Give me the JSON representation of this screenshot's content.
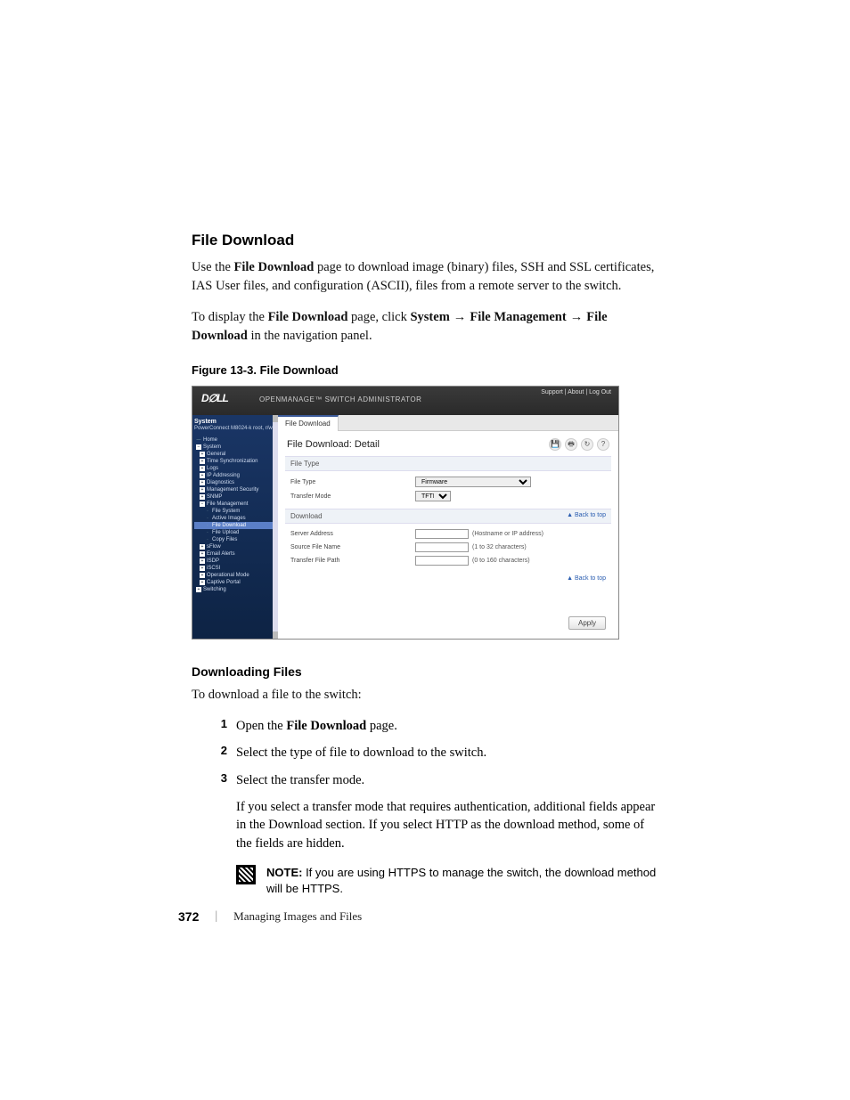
{
  "heading": "File Download",
  "intro": "Use the File Download page to download image (binary) files, SSH and SSL certificates, IAS User files, and configuration (ASCII), files from a remote server to the switch.",
  "intro_bold1": "File Download",
  "nav_text_pre": "To display the ",
  "nav_text_bold1": "File Download",
  "nav_text_mid1": " page, click ",
  "nav_text_bold2": "System",
  "nav_text_mid2": " → ",
  "nav_text_bold3": "File Management",
  "nav_text_mid3": " → ",
  "nav_text_bold4": "File Download",
  "nav_text_post": " in the navigation panel.",
  "figure_caption": "Figure 13-3.    File Download",
  "screenshot": {
    "logo": "D∅LL",
    "title": "OPENMANAGE™ SWITCH ADMINISTRATOR",
    "links": "Support | About | Log Out",
    "sidebar": {
      "system_label": "System",
      "system_sub": "PowerConnect M8024-k root, r/w",
      "tree": [
        {
          "lv": 0,
          "box": "—",
          "label": "Home"
        },
        {
          "lv": 0,
          "box": "−",
          "label": "System"
        },
        {
          "lv": 1,
          "box": "+",
          "label": "General"
        },
        {
          "lv": 1,
          "box": "+",
          "label": "Time Synchronization"
        },
        {
          "lv": 1,
          "box": "+",
          "label": "Logs"
        },
        {
          "lv": 1,
          "box": "+",
          "label": "IP Addressing"
        },
        {
          "lv": 1,
          "box": "+",
          "label": "Diagnostics"
        },
        {
          "lv": 1,
          "box": "+",
          "label": "Management Security"
        },
        {
          "lv": 1,
          "box": "+",
          "label": "SNMP"
        },
        {
          "lv": 1,
          "box": "−",
          "label": "File Management"
        },
        {
          "lv": 2,
          "box": "",
          "label": "File System"
        },
        {
          "lv": 2,
          "box": "",
          "label": "Active Images"
        },
        {
          "lv": 2,
          "box": "",
          "label": "File Download",
          "sel": true
        },
        {
          "lv": 2,
          "box": "",
          "label": "File Upload"
        },
        {
          "lv": 2,
          "box": "",
          "label": "Copy Files"
        },
        {
          "lv": 1,
          "box": "+",
          "label": "sFlow"
        },
        {
          "lv": 1,
          "box": "+",
          "label": "Email Alerts"
        },
        {
          "lv": 1,
          "box": "+",
          "label": "ISDP"
        },
        {
          "lv": 1,
          "box": "+",
          "label": "iSCSI"
        },
        {
          "lv": 1,
          "box": "+",
          "label": "Operational Mode"
        },
        {
          "lv": 1,
          "box": "+",
          "label": "Captive Portal"
        },
        {
          "lv": 0,
          "box": "+",
          "label": "Switching"
        }
      ]
    },
    "tab": "File Download",
    "panel_title": "File Download: Detail",
    "icons": {
      "save": "💾",
      "print": "🖶",
      "refresh": "↻",
      "help": "?"
    },
    "sections": {
      "file_type_header": "File Type",
      "file_type_label": "File Type",
      "file_type_value": "Firmware",
      "transfer_mode_label": "Transfer Mode",
      "transfer_mode_value": "TFTP",
      "download_header": "Download",
      "server_address_label": "Server Address",
      "server_address_hint": "(Hostname or IP address)",
      "source_file_label": "Source File Name",
      "source_file_hint": "(1 to 32 characters)",
      "transfer_path_label": "Transfer File Path",
      "transfer_path_hint": "(0 to 160 characters)",
      "back_to_top": "▲ Back to top"
    },
    "apply": "Apply"
  },
  "downloading_heading": "Downloading Files",
  "downloading_intro": "To download a file to the switch:",
  "steps": [
    {
      "num": "1",
      "text_pre": "Open the ",
      "text_bold": "File Download",
      "text_post": " page."
    },
    {
      "num": "2",
      "text": "Select the type of file to download to the switch."
    },
    {
      "num": "3",
      "text": "Select the transfer mode."
    }
  ],
  "step3_sub": "If you select a transfer mode that requires authentication, additional fields appear in the Download section. If you select HTTP as the download method, some of the fields are hidden.",
  "note_label": "NOTE:",
  "note_text": " If you are using HTTPS to manage the switch, the download method will be HTTPS.",
  "footer": {
    "page": "372",
    "sep": "|",
    "title": "Managing Images and Files"
  }
}
